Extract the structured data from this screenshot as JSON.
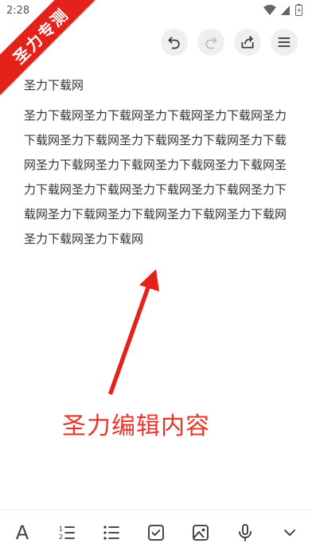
{
  "status_bar": {
    "time": "2:28"
  },
  "watermark": {
    "text": "圣力专测"
  },
  "note": {
    "title": "圣力下载网",
    "body": "圣力下载网圣力下载网圣力下载网圣力下载网圣力下载网圣力下载网圣力下载网圣力下载网圣力下载网圣力下载网圣力下载网圣力下载网圣力下载网圣力下载网圣力下载网圣力下载网圣力下载网圣力下载网圣力下载网圣力下载网圣力下载网圣力下载网圣力下载网圣力下载网"
  },
  "annotation": {
    "text": "圣力编辑内容",
    "color": "#e8342b"
  },
  "icons": {
    "toolbar": [
      "undo-icon",
      "redo-icon",
      "share-icon",
      "menu-icon"
    ],
    "bottom": [
      "text-format-icon",
      "numbered-list-icon",
      "bulleted-list-icon",
      "checkbox-icon",
      "image-icon",
      "microphone-icon",
      "chevron-down-icon"
    ]
  },
  "colors": {
    "ribbon": "#e5221a",
    "button_bg": "#efefef"
  }
}
